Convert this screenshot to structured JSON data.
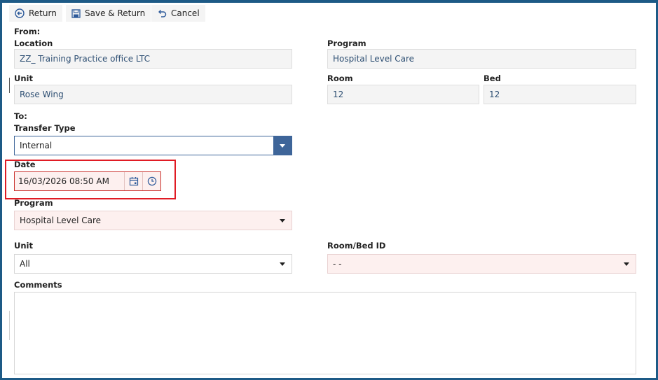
{
  "toolbar": {
    "return_label": "Return",
    "save_return_label": "Save & Return",
    "cancel_label": "Cancel"
  },
  "from": {
    "heading": "From:",
    "location_label": "Location",
    "location_value": "ZZ_ Training Practice office LTC",
    "program_label": "Program",
    "program_value": "Hospital Level Care",
    "unit_label": "Unit",
    "unit_value": "Rose Wing",
    "room_label": "Room",
    "room_value": "12",
    "bed_label": "Bed",
    "bed_value": "12"
  },
  "to": {
    "heading": "To:",
    "transfer_type_label": "Transfer Type",
    "transfer_type_value": "Internal",
    "date_label": "Date",
    "date_value": "16/03/2026 08:50 AM",
    "program_label": "Program",
    "program_value": "Hospital Level Care",
    "unit_label": "Unit",
    "unit_value": "All",
    "roombed_label": "Room/Bed ID",
    "roombed_value": "- -",
    "comments_label": "Comments",
    "comments_value": ""
  },
  "colors": {
    "accent": "#3e6599",
    "required_bg": "#fdf0ef",
    "highlight": "#e01b24",
    "window_border": "#1d5a86"
  },
  "icons": {
    "return": "return-circle-icon",
    "save": "save-disk-icon",
    "cancel": "undo-icon",
    "calendar": "calendar-icon",
    "clock": "clock-icon",
    "dropdown": "chevron-down-icon"
  }
}
